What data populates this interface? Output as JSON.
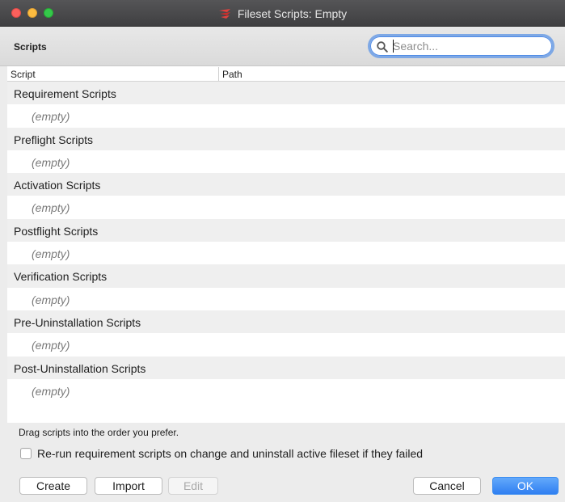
{
  "window": {
    "title": "Fileset Scripts: Empty"
  },
  "header": {
    "title": "Scripts"
  },
  "search": {
    "placeholder": "Search...",
    "value": ""
  },
  "table": {
    "columns": [
      "Script",
      "Path"
    ],
    "rows": [
      {
        "type": "group",
        "label": "Requirement Scripts"
      },
      {
        "type": "item",
        "label": "(empty)"
      },
      {
        "type": "group",
        "label": "Preflight Scripts"
      },
      {
        "type": "item",
        "label": "(empty)"
      },
      {
        "type": "group",
        "label": "Activation Scripts"
      },
      {
        "type": "item",
        "label": "(empty)"
      },
      {
        "type": "group",
        "label": "Postflight Scripts"
      },
      {
        "type": "item",
        "label": "(empty)"
      },
      {
        "type": "group",
        "label": "Verification Scripts"
      },
      {
        "type": "item",
        "label": "(empty)"
      },
      {
        "type": "group",
        "label": "Pre-Uninstallation Scripts"
      },
      {
        "type": "item",
        "label": "(empty)"
      },
      {
        "type": "group",
        "label": "Post-Uninstallation Scripts"
      },
      {
        "type": "item",
        "label": "(empty)"
      }
    ]
  },
  "footer": {
    "hint": "Drag scripts into the order you prefer.",
    "rerun_checkbox": {
      "label": "Re-run requirement scripts on change and uninstall active fileset if they failed",
      "checked": false
    }
  },
  "buttons": {
    "create": "Create",
    "import": "Import",
    "edit": "Edit",
    "cancel": "Cancel",
    "ok": "OK"
  },
  "colors": {
    "accent": "#2f7ff1",
    "group_row_bg": "#efefef",
    "empty_text": "#7a7a7a"
  }
}
